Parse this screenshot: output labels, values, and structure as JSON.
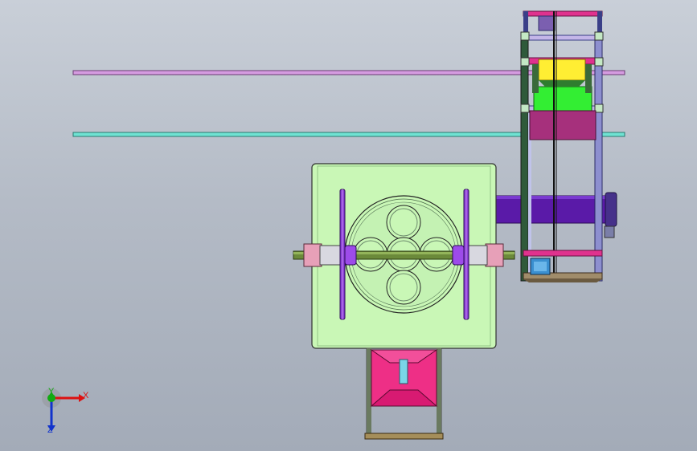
{
  "viewport": {
    "background_top": "#c9cfd8",
    "background_bottom": "#a3abb8"
  },
  "model": {
    "rails": [
      {
        "name": "upper-rail",
        "color": "#d59be0"
      },
      {
        "name": "lower-rail",
        "color": "#6fe2d2"
      }
    ],
    "colors": {
      "base_plate": "#c9f7b6",
      "shaft": "#6b8a3a",
      "disc": "#8a3fd6",
      "bearing": "#e7a0b8",
      "hopper": "#ee2f86",
      "conveyor": "#5a1aa8",
      "frame": "#3a3f88",
      "yellow_block": "#ffee33",
      "green_block": "#33ee33",
      "purple_block": "#a6307c"
    }
  },
  "triad": {
    "x_label": "X",
    "y_label": "Y",
    "z_label": "Z",
    "x_color": "#dd1111",
    "y_color": "#11aa11",
    "z_color": "#1133cc"
  }
}
